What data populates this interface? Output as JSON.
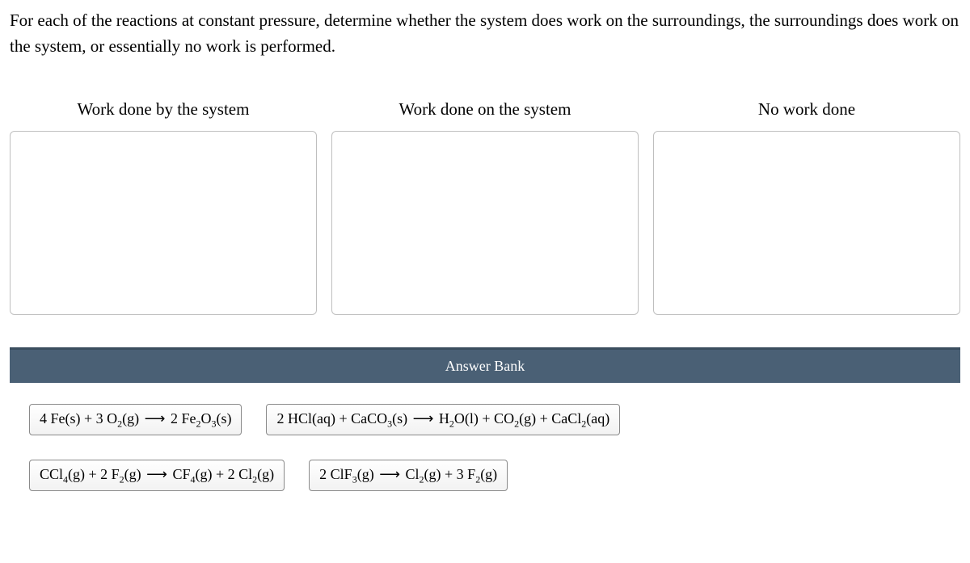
{
  "question": "For each of the reactions at constant pressure, determine whether the system does work on the surroundings, the surroundings does work on the system, or essentially no work is performed.",
  "columns": [
    {
      "title": "Work done by the system"
    },
    {
      "title": "Work done on the system"
    },
    {
      "title": "No work done"
    }
  ],
  "bank_title": "Answer Bank",
  "reactions": {
    "r1": "4 Fe(s) + 3 O₂(g) ⟶ 2 Fe₂O₃(s)",
    "r2": "2 HCl(aq) + CaCO₃(s) ⟶ H₂O(l) + CO₂(g) + CaCl₂(aq)",
    "r3": "CCl₄(g) + 2 F₂(g) ⟶ CF₄(g) + 2 Cl₂(g)",
    "r4": "2 ClF₃(g) ⟶ Cl₂(g) + 3 F₂(g)"
  }
}
